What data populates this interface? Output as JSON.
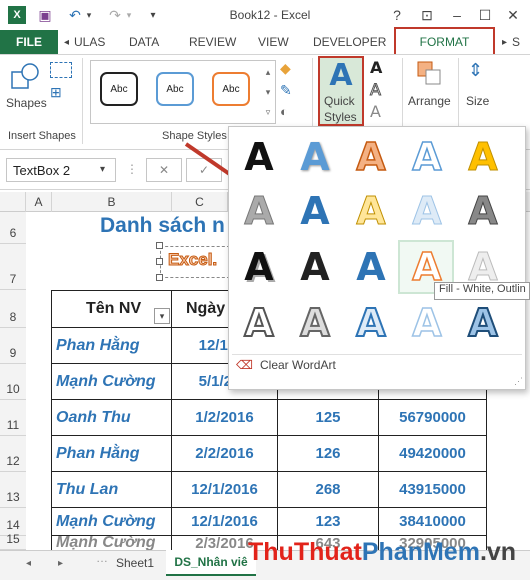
{
  "window": {
    "title": "Book12 - Excel"
  },
  "window_buttons": {
    "help": "?",
    "restore_ribbon": "⊡",
    "minimize": "–",
    "maximize": "☐",
    "close": "✕"
  },
  "tabs": {
    "file": "FILE",
    "formulas_partial": "ULAS",
    "data": "DATA",
    "review": "REVIEW",
    "view": "VIEW",
    "developer": "DEVELOPER",
    "format": "FORMAT",
    "share_partial": "S"
  },
  "ribbon": {
    "shapes": "Shapes",
    "insert_shapes_label": "Insert Shapes",
    "swatch_text": [
      "Abc",
      "Abc",
      "Abc"
    ],
    "swatch_colors": [
      "#222222",
      "#5b9bd5",
      "#ed7d31"
    ],
    "shape_styles_label": "Shape Styles",
    "quick_styles": [
      "Quick",
      "Styles"
    ],
    "arrange": "Arrange",
    "size": "Size"
  },
  "formula_bar": {
    "name_box": "TextBox 2",
    "fx_cancel": "✕",
    "fx_enter": "✓"
  },
  "columns": [
    "A",
    "B",
    "C"
  ],
  "rows": [
    "6",
    "7",
    "8",
    "9",
    "10",
    "11",
    "12",
    "13",
    "14",
    "15"
  ],
  "sheet": {
    "title_partial": "Danh sách n",
    "textbox_text": "Excel.",
    "header_name": "Tên NV",
    "header_date_partial": "Ngày",
    "data": [
      {
        "name": "Phan Hằng",
        "date": "12/1/",
        "qty": "",
        "amount": ""
      },
      {
        "name": "Mạnh Cường",
        "date": "5/1/2",
        "qty": "",
        "amount": ""
      },
      {
        "name": "Oanh Thu",
        "date": "1/2/2016",
        "qty": "125",
        "amount": "56790000"
      },
      {
        "name": "Phan Hằng",
        "date": "2/2/2016",
        "qty": "126",
        "amount": "49420000"
      },
      {
        "name": "Thu Lan",
        "date": "12/1/2016",
        "qty": "268",
        "amount": "43915000"
      },
      {
        "name": "Mạnh Cường",
        "date": "12/1/2016",
        "qty": "123",
        "amount": "38410000"
      },
      {
        "name": "Mạnh Cường",
        "date": "2/3/2016",
        "qty": "643",
        "amount": "32905000"
      }
    ]
  },
  "gallery": {
    "glyph": "A",
    "tooltip": "Fill - White, Outlin",
    "clear_wordart": "Clear WordArt"
  },
  "sheet_tabs": {
    "sheet1": "Sheet1",
    "active": "DS_Nhân viê"
  },
  "watermark": {
    "part1": "ThuThuat",
    "part2": "PhanMem",
    "part3": ".vn"
  }
}
